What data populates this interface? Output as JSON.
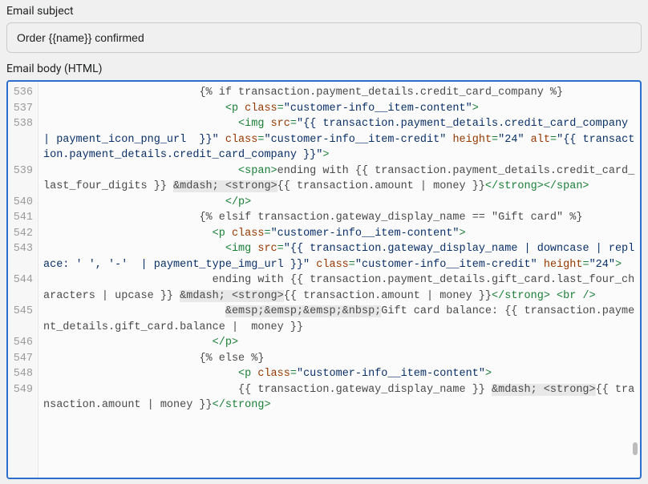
{
  "subject": {
    "label": "Email subject",
    "value": "Order {{name}} confirmed"
  },
  "body": {
    "label": "Email body (HTML)",
    "gutter_start": 536,
    "lines": [
      {
        "n": 536,
        "indent": 24,
        "segs": [
          {
            "c": "tpl",
            "t": "{% if transaction.payment_details.credit_card_company %}"
          }
        ]
      },
      {
        "n": 537,
        "indent": 28,
        "segs": [
          {
            "c": "tag",
            "t": "<p "
          },
          {
            "c": "attr",
            "t": "class"
          },
          {
            "c": "tag",
            "t": "="
          },
          {
            "c": "str",
            "t": "\"customer-info__item-content\""
          },
          {
            "c": "tag",
            "t": ">"
          }
        ]
      },
      {
        "n": 538,
        "indent": 30,
        "segs": [
          {
            "c": "tag",
            "t": "<img "
          },
          {
            "c": "attr",
            "t": "src"
          },
          {
            "c": "tag",
            "t": "="
          },
          {
            "c": "str",
            "t": "\"{{ transaction.payment_details.credit_card_company | payment_icon_png_url  }}\""
          },
          {
            "c": "tag",
            "t": " "
          },
          {
            "c": "attr",
            "t": "class"
          },
          {
            "c": "tag",
            "t": "="
          },
          {
            "c": "str",
            "t": "\"customer-info__item-credit\""
          },
          {
            "c": "tag",
            "t": " "
          },
          {
            "c": "attr",
            "t": "height"
          },
          {
            "c": "tag",
            "t": "="
          },
          {
            "c": "str",
            "t": "\"24\""
          },
          {
            "c": "tag",
            "t": " "
          },
          {
            "c": "attr",
            "t": "alt"
          },
          {
            "c": "tag",
            "t": "="
          },
          {
            "c": "str",
            "t": "\"{{ transaction.payment_details.credit_card_company }}\""
          },
          {
            "c": "tag",
            "t": ">"
          }
        ]
      },
      {
        "n": 539,
        "indent": 30,
        "segs": [
          {
            "c": "tag",
            "t": "<span>"
          },
          {
            "c": "tpl",
            "t": "ending with {{ transaction.payment_details.credit_card_last_four_digits }} "
          },
          {
            "c": "ent",
            "t": "&mdash; <strong>"
          },
          {
            "c": "tpl",
            "t": "{{ transaction.amount | money }}"
          },
          {
            "c": "tag",
            "t": "</strong>"
          },
          {
            "c": "tag",
            "t": "</span>"
          }
        ]
      },
      {
        "n": 540,
        "indent": 28,
        "segs": [
          {
            "c": "tag",
            "t": "</p>"
          }
        ]
      },
      {
        "n": 541,
        "indent": 24,
        "segs": [
          {
            "c": "tpl",
            "t": "{% elsif transaction.gateway_display_name == \"Gift card\" %}"
          }
        ]
      },
      {
        "n": 542,
        "indent": 26,
        "segs": [
          {
            "c": "tag",
            "t": "<p "
          },
          {
            "c": "attr",
            "t": "class"
          },
          {
            "c": "tag",
            "t": "="
          },
          {
            "c": "str",
            "t": "\"customer-info__item-content\""
          },
          {
            "c": "tag",
            "t": ">"
          }
        ]
      },
      {
        "n": 543,
        "indent": 28,
        "segs": [
          {
            "c": "tag",
            "t": "<img "
          },
          {
            "c": "attr",
            "t": "src"
          },
          {
            "c": "tag",
            "t": "="
          },
          {
            "c": "str",
            "t": "\"{{ transaction.gateway_display_name | downcase | replace: ' ', '-'  | payment_type_img_url }}\""
          },
          {
            "c": "tag",
            "t": " "
          },
          {
            "c": "attr",
            "t": "class"
          },
          {
            "c": "tag",
            "t": "="
          },
          {
            "c": "str",
            "t": "\"customer-info__item-credit\""
          },
          {
            "c": "tag",
            "t": " "
          },
          {
            "c": "attr",
            "t": "height"
          },
          {
            "c": "tag",
            "t": "="
          },
          {
            "c": "str",
            "t": "\"24\""
          },
          {
            "c": "tag",
            "t": ">"
          }
        ]
      },
      {
        "n": 544,
        "indent": 26,
        "segs": [
          {
            "c": "tpl",
            "t": "ending with {{ transaction.payment_details.gift_card.last_four_characters | upcase }} "
          },
          {
            "c": "ent",
            "t": "&mdash; <strong>"
          },
          {
            "c": "tpl",
            "t": "{{ transaction.amount | money }}"
          },
          {
            "c": "tag",
            "t": "</strong>"
          },
          {
            "c": "tpl",
            "t": " "
          },
          {
            "c": "tag",
            "t": "<br />"
          }
        ]
      },
      {
        "n": 545,
        "indent": 28,
        "segs": [
          {
            "c": "ent",
            "t": "&emsp;&emsp;&emsp;&nbsp;"
          },
          {
            "c": "tpl",
            "t": "Gift card balance: {{ transaction.payment_details.gift_card.balance |  money }}"
          }
        ]
      },
      {
        "n": 546,
        "indent": 26,
        "segs": [
          {
            "c": "tag",
            "t": "</p>"
          }
        ]
      },
      {
        "n": 547,
        "indent": 24,
        "segs": [
          {
            "c": "tpl",
            "t": "{% else %}"
          }
        ]
      },
      {
        "n": 548,
        "indent": 30,
        "segs": [
          {
            "c": "tag",
            "t": "<p "
          },
          {
            "c": "attr",
            "t": "class"
          },
          {
            "c": "tag",
            "t": "="
          },
          {
            "c": "str",
            "t": "\"customer-info__item-content\""
          },
          {
            "c": "tag",
            "t": ">"
          }
        ]
      },
      {
        "n": 549,
        "indent": 30,
        "segs": [
          {
            "c": "tpl",
            "t": "{{ transaction.gateway_display_name }} "
          },
          {
            "c": "ent",
            "t": "&mdash; <strong>"
          },
          {
            "c": "tpl",
            "t": "{{ transaction.amount | money }}"
          },
          {
            "c": "tag",
            "t": "</strong>"
          }
        ]
      }
    ]
  }
}
